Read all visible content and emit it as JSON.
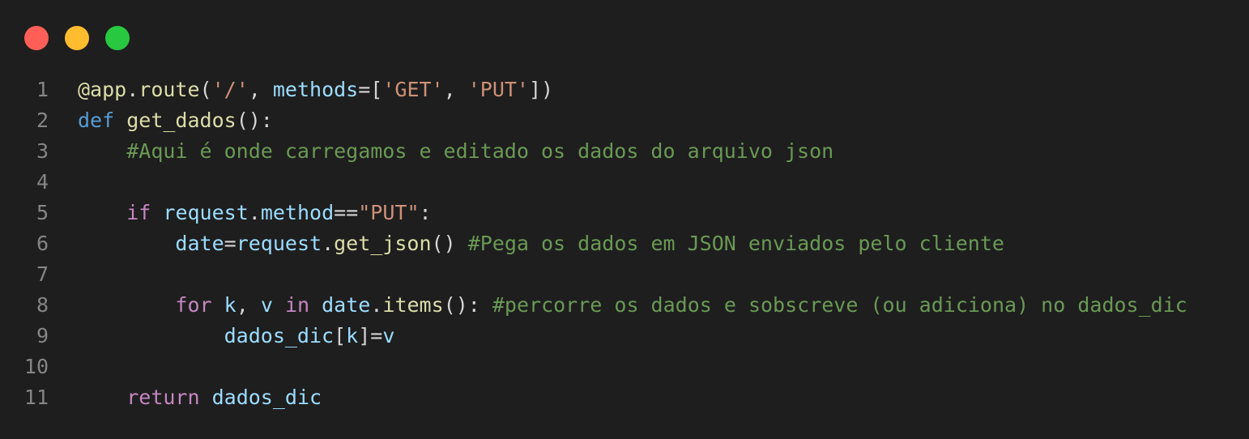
{
  "colors": {
    "background": "#1e1e1e",
    "close": "#ff5f57",
    "minimize": "#febc2e",
    "maximize": "#28c840",
    "line_number": "#858585",
    "default": "#d4d4d4",
    "keyword_blue": "#569cd6",
    "keyword_control": "#c586c0",
    "function": "#dcdcaa",
    "variable": "#9cdcfe",
    "string": "#ce9178",
    "comment": "#6a9955"
  },
  "window_controls": [
    {
      "name": "close-button",
      "color": "#ff5f57"
    },
    {
      "name": "minimize-button",
      "color": "#febc2e"
    },
    {
      "name": "maximize-button",
      "color": "#28c840"
    }
  ],
  "code": {
    "language": "python",
    "lines": [
      {
        "number": "1",
        "tokens": [
          {
            "text": "@app",
            "color": "#dcdcaa"
          },
          {
            "text": ".",
            "color": "#d4d4d4"
          },
          {
            "text": "route",
            "color": "#dcdcaa"
          },
          {
            "text": "(",
            "color": "#d4d4d4"
          },
          {
            "text": "'/'",
            "color": "#ce9178"
          },
          {
            "text": ", ",
            "color": "#d4d4d4"
          },
          {
            "text": "methods",
            "color": "#9cdcfe"
          },
          {
            "text": "=[",
            "color": "#d4d4d4"
          },
          {
            "text": "'GET'",
            "color": "#ce9178"
          },
          {
            "text": ", ",
            "color": "#d4d4d4"
          },
          {
            "text": "'PUT'",
            "color": "#ce9178"
          },
          {
            "text": "])",
            "color": "#d4d4d4"
          }
        ]
      },
      {
        "number": "2",
        "tokens": [
          {
            "text": "def",
            "color": "#569cd6"
          },
          {
            "text": " ",
            "color": "#d4d4d4"
          },
          {
            "text": "get_dados",
            "color": "#dcdcaa"
          },
          {
            "text": "():",
            "color": "#d4d4d4"
          }
        ]
      },
      {
        "number": "3",
        "tokens": [
          {
            "text": "    ",
            "color": "#d4d4d4"
          },
          {
            "text": "#Aqui é onde carregamos e editado os dados do arquivo json",
            "color": "#6a9955"
          }
        ]
      },
      {
        "number": "4",
        "tokens": []
      },
      {
        "number": "5",
        "tokens": [
          {
            "text": "    ",
            "color": "#d4d4d4"
          },
          {
            "text": "if",
            "color": "#c586c0"
          },
          {
            "text": " ",
            "color": "#d4d4d4"
          },
          {
            "text": "request",
            "color": "#9cdcfe"
          },
          {
            "text": ".",
            "color": "#d4d4d4"
          },
          {
            "text": "method",
            "color": "#9cdcfe"
          },
          {
            "text": "==",
            "color": "#d4d4d4"
          },
          {
            "text": "\"PUT\"",
            "color": "#ce9178"
          },
          {
            "text": ":",
            "color": "#d4d4d4"
          }
        ]
      },
      {
        "number": "6",
        "tokens": [
          {
            "text": "        ",
            "color": "#d4d4d4"
          },
          {
            "text": "date",
            "color": "#9cdcfe"
          },
          {
            "text": "=",
            "color": "#d4d4d4"
          },
          {
            "text": "request",
            "color": "#9cdcfe"
          },
          {
            "text": ".",
            "color": "#d4d4d4"
          },
          {
            "text": "get_json",
            "color": "#dcdcaa"
          },
          {
            "text": "() ",
            "color": "#d4d4d4"
          },
          {
            "text": "#Pega os dados em JSON enviados pelo cliente",
            "color": "#6a9955"
          }
        ]
      },
      {
        "number": "7",
        "tokens": []
      },
      {
        "number": "8",
        "tokens": [
          {
            "text": "        ",
            "color": "#d4d4d4"
          },
          {
            "text": "for",
            "color": "#c586c0"
          },
          {
            "text": " ",
            "color": "#d4d4d4"
          },
          {
            "text": "k",
            "color": "#9cdcfe"
          },
          {
            "text": ", ",
            "color": "#d4d4d4"
          },
          {
            "text": "v",
            "color": "#9cdcfe"
          },
          {
            "text": " ",
            "color": "#d4d4d4"
          },
          {
            "text": "in",
            "color": "#c586c0"
          },
          {
            "text": " ",
            "color": "#d4d4d4"
          },
          {
            "text": "date",
            "color": "#9cdcfe"
          },
          {
            "text": ".",
            "color": "#d4d4d4"
          },
          {
            "text": "items",
            "color": "#dcdcaa"
          },
          {
            "text": "(): ",
            "color": "#d4d4d4"
          },
          {
            "text": "#percorre os dados e sobscreve (ou adiciona) no dados_dic",
            "color": "#6a9955"
          }
        ]
      },
      {
        "number": "9",
        "tokens": [
          {
            "text": "            ",
            "color": "#d4d4d4"
          },
          {
            "text": "dados_dic",
            "color": "#9cdcfe"
          },
          {
            "text": "[",
            "color": "#d4d4d4"
          },
          {
            "text": "k",
            "color": "#9cdcfe"
          },
          {
            "text": "]=",
            "color": "#d4d4d4"
          },
          {
            "text": "v",
            "color": "#9cdcfe"
          }
        ]
      },
      {
        "number": "10",
        "tokens": []
      },
      {
        "number": "11",
        "tokens": [
          {
            "text": "    ",
            "color": "#d4d4d4"
          },
          {
            "text": "return",
            "color": "#c586c0"
          },
          {
            "text": " ",
            "color": "#d4d4d4"
          },
          {
            "text": "dados_dic",
            "color": "#9cdcfe"
          }
        ]
      }
    ]
  }
}
